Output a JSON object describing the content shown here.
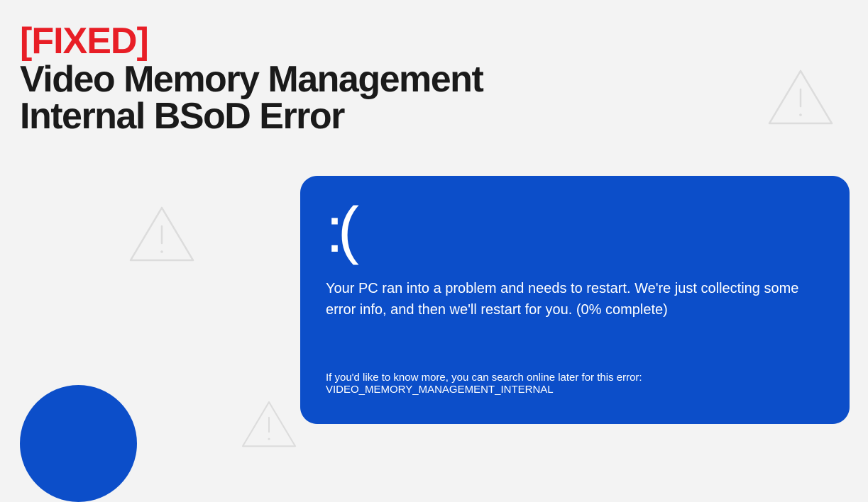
{
  "header": {
    "fixed_tag": "[FIXED]",
    "title_line1": "Video Memory Management",
    "title_line2": "Internal BSoD Error"
  },
  "bsod": {
    "sad_face": ":(",
    "message": "Your PC ran into a problem and needs to restart. We're just collecting some error info, and then we'll restart for you. (0% complete)",
    "detail_prefix": "If you'd like to know more, you can search online later for this error: ",
    "error_code": "VIDEO_MEMORY_MANAGEMENT_INTERNAL"
  }
}
